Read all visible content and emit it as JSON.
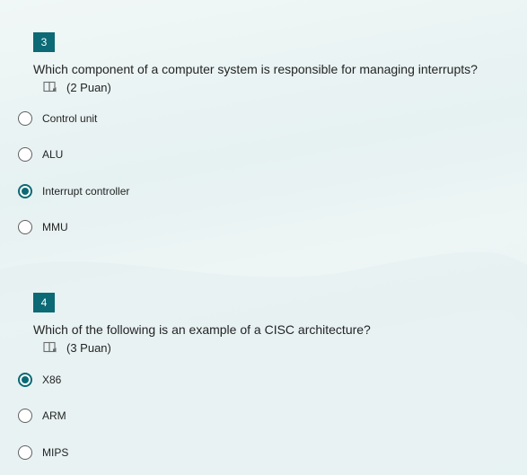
{
  "questions": [
    {
      "number": "3",
      "text": "Which component of a computer system is responsible for managing interrupts?",
      "points": "(2 Puan)",
      "options": [
        {
          "label": "Control unit",
          "selected": false
        },
        {
          "label": "ALU",
          "selected": false
        },
        {
          "label": "Interrupt controller",
          "selected": true
        },
        {
          "label": "MMU",
          "selected": false
        }
      ]
    },
    {
      "number": "4",
      "text": "Which of the following is an example of a CISC architecture?",
      "points": "(3 Puan)",
      "options": [
        {
          "label": "X86",
          "selected": true
        },
        {
          "label": "ARM",
          "selected": false
        },
        {
          "label": "MIPS",
          "selected": false
        }
      ]
    }
  ],
  "colors": {
    "accent": "#0b6a75",
    "text": "#242424",
    "radio_border": "#616161"
  },
  "icons": {
    "points": "immersive-reader-icon"
  }
}
